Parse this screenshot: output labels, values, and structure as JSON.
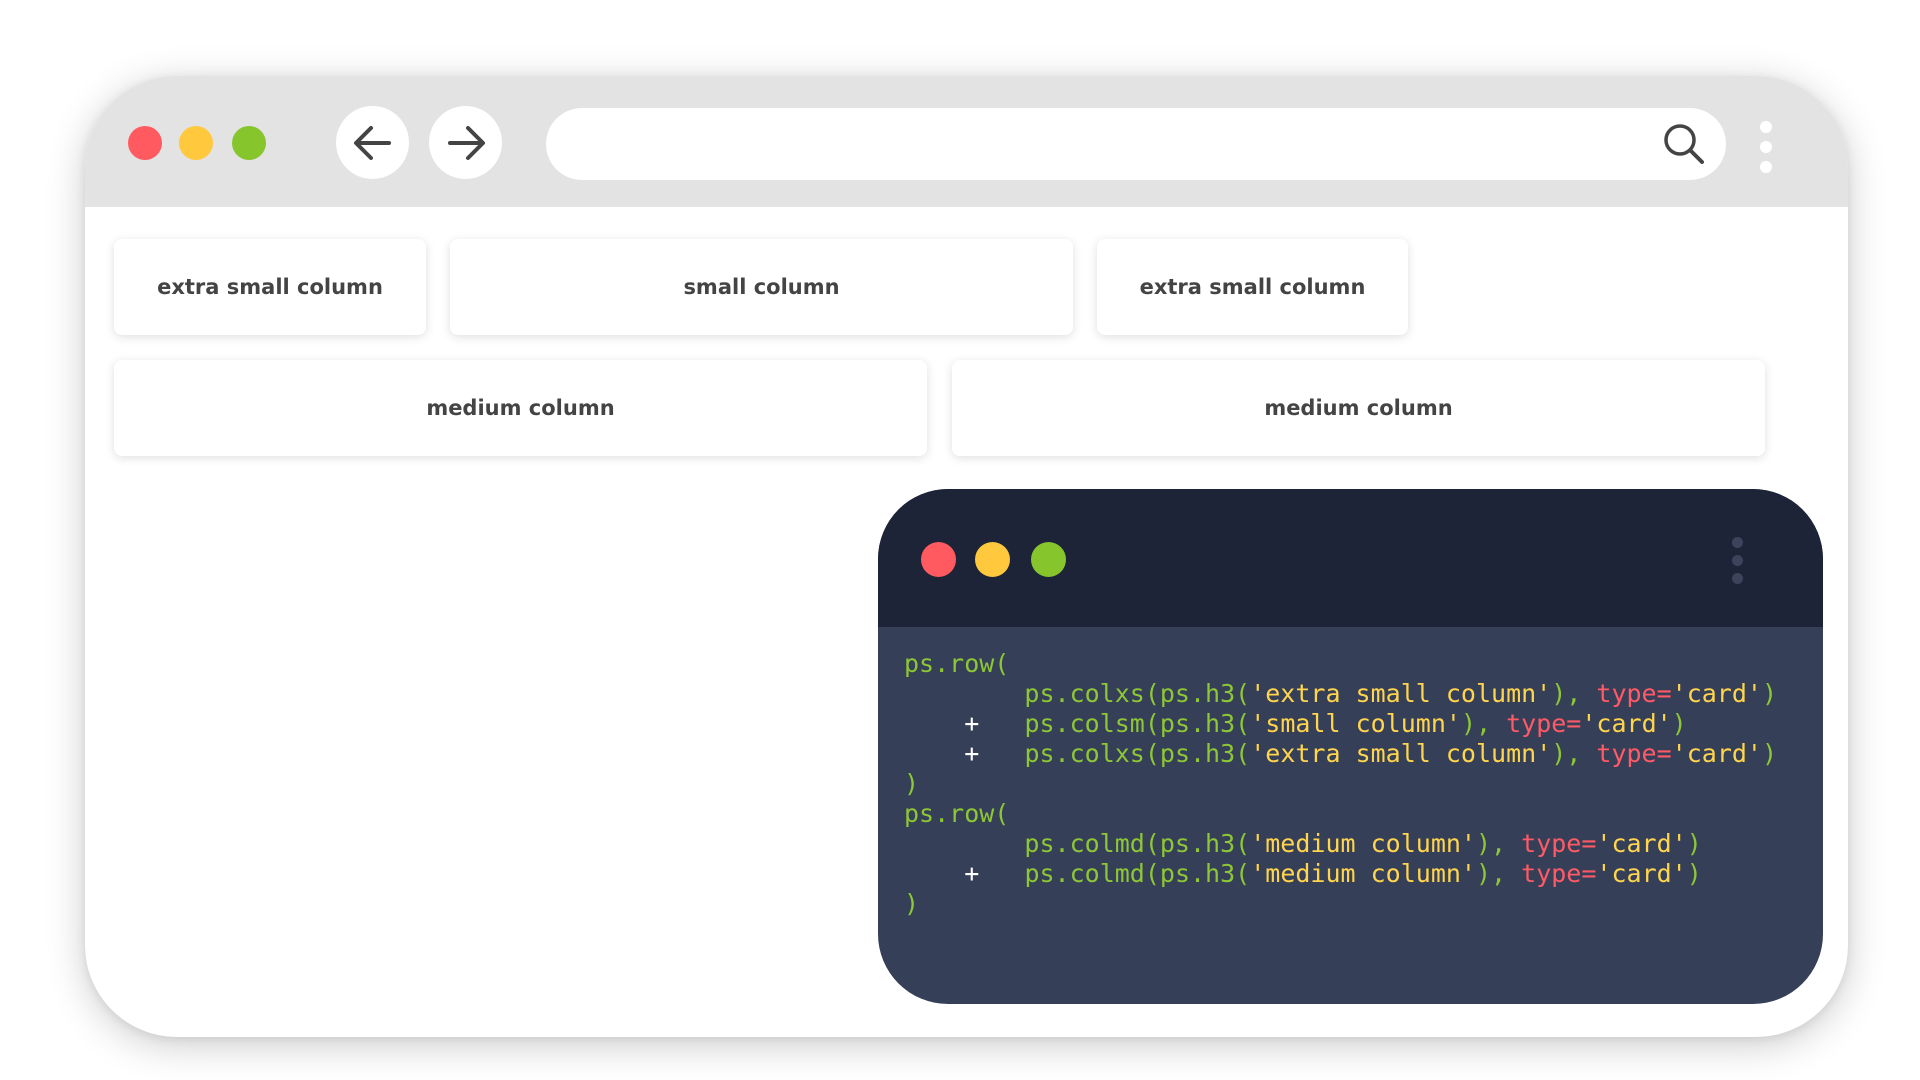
{
  "colors": {
    "close": "#ff5a5f",
    "minimize": "#ffc83d",
    "maximize": "#86c52c",
    "code_green": "#8dc735",
    "code_yellow": "#ffd54d",
    "code_red": "#ff5a66",
    "terminal_bg": "#363f58",
    "terminal_bar": "#1e2438"
  },
  "browser": {
    "controls": [
      "close-dot",
      "minimize-dot",
      "maximize-dot"
    ],
    "nav": {
      "back_icon": "arrow-left-icon",
      "forward_icon": "arrow-right-icon"
    },
    "address": {
      "value": "",
      "icon": "search-icon"
    },
    "menu_icon": "kebab-menu-icon"
  },
  "page": {
    "row1": [
      {
        "label": "extra small column"
      },
      {
        "label": "small column"
      },
      {
        "label": "extra small column"
      }
    ],
    "row2": [
      {
        "label": "medium column"
      },
      {
        "label": "medium column"
      }
    ]
  },
  "terminal": {
    "menu_icon": "kebab-menu-icon",
    "code_lines": [
      [
        {
          "t": "ps.row(",
          "c": "g"
        }
      ],
      [
        {
          "t": "        ",
          "c": "g"
        },
        {
          "t": "ps.colxs(ps.h3(",
          "c": "g"
        },
        {
          "t": "'extra small column'",
          "c": "y"
        },
        {
          "t": "), ",
          "c": "g"
        },
        {
          "t": "type=",
          "c": "r"
        },
        {
          "t": "'card'",
          "c": "y"
        },
        {
          "t": ")",
          "c": "g"
        }
      ],
      [
        {
          "t": "    ",
          "c": "w"
        },
        {
          "t": "+",
          "c": "w"
        },
        {
          "t": "   ",
          "c": "w"
        },
        {
          "t": "ps.colsm(ps.h3(",
          "c": "g"
        },
        {
          "t": "'small column'",
          "c": "y"
        },
        {
          "t": "), ",
          "c": "g"
        },
        {
          "t": "type=",
          "c": "r"
        },
        {
          "t": "'card'",
          "c": "y"
        },
        {
          "t": ")",
          "c": "g"
        }
      ],
      [
        {
          "t": "    ",
          "c": "w"
        },
        {
          "t": "+",
          "c": "w"
        },
        {
          "t": "   ",
          "c": "w"
        },
        {
          "t": "ps.colxs(ps.h3(",
          "c": "g"
        },
        {
          "t": "'extra small column'",
          "c": "y"
        },
        {
          "t": "), ",
          "c": "g"
        },
        {
          "t": "type=",
          "c": "r"
        },
        {
          "t": "'card'",
          "c": "y"
        },
        {
          "t": ")",
          "c": "g"
        }
      ],
      [
        {
          "t": ")",
          "c": "g"
        }
      ],
      [
        {
          "t": "ps.row(",
          "c": "g"
        }
      ],
      [
        {
          "t": "        ",
          "c": "g"
        },
        {
          "t": "ps.colmd(ps.h3(",
          "c": "g"
        },
        {
          "t": "'medium column'",
          "c": "y"
        },
        {
          "t": "), ",
          "c": "g"
        },
        {
          "t": "type=",
          "c": "r"
        },
        {
          "t": "'card'",
          "c": "y"
        },
        {
          "t": ")",
          "c": "g"
        }
      ],
      [
        {
          "t": "    ",
          "c": "w"
        },
        {
          "t": "+",
          "c": "w"
        },
        {
          "t": "   ",
          "c": "w"
        },
        {
          "t": "ps.colmd(ps.h3(",
          "c": "g"
        },
        {
          "t": "'medium column'",
          "c": "y"
        },
        {
          "t": "), ",
          "c": "g"
        },
        {
          "t": "type=",
          "c": "r"
        },
        {
          "t": "'card'",
          "c": "y"
        },
        {
          "t": ")",
          "c": "g"
        }
      ],
      [
        {
          "t": ")",
          "c": "g"
        }
      ]
    ]
  }
}
